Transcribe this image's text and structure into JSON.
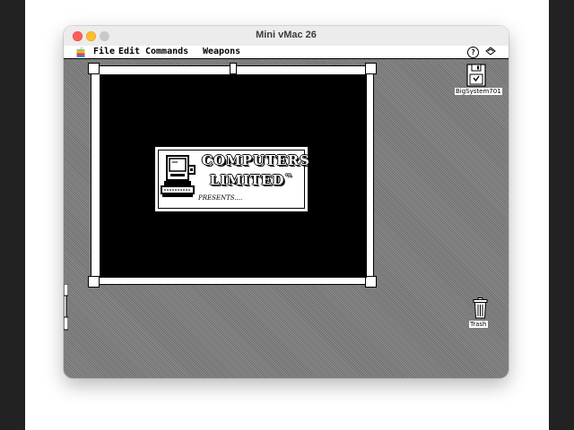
{
  "host_window": {
    "title": "Mini vMac 26"
  },
  "menubar": {
    "apple_icon": "rainbow-apple-icon",
    "items": [
      {
        "label": "File"
      },
      {
        "label": "Edit"
      },
      {
        "label": "Commands"
      },
      {
        "label": "Weapons"
      }
    ],
    "right_icons": [
      "help-balloon-icon",
      "application-menu-icon"
    ]
  },
  "game": {
    "title_line1": "COMPUTERS",
    "title_line2": "LIMITED",
    "trademark": "™",
    "subtitle": "PRESENTS....",
    "logo_icon": "vintage-computer-icon",
    "background_icon": "computer-tile-icon"
  },
  "desktop": {
    "disk_label": "BigSystem701",
    "disk_icon": "floppy-disk-icon",
    "trash_label": "Trash",
    "trash_icon": "trash-can-icon"
  },
  "colors": {
    "close": "#ff5f57",
    "minimize": "#febc2e",
    "zoom_inactive": "#c9c9c9",
    "desktop_gray": "#7e7e7e"
  }
}
